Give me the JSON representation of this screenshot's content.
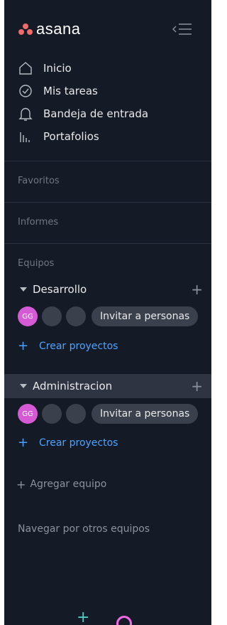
{
  "app": {
    "logo_text": "asana",
    "logo_colors": [
      "#f06a6a",
      "#f06a6a",
      "#f06a6a"
    ],
    "collapse_icon": "sidebar-collapse-icon"
  },
  "nav": {
    "items": [
      {
        "label": "Inicio",
        "icon": "home-icon"
      },
      {
        "label": "Mis tareas",
        "icon": "check-circle-icon"
      },
      {
        "label": "Bandeja de entrada",
        "icon": "bell-icon"
      },
      {
        "label": "Portafolios",
        "icon": "bar-chart-icon"
      }
    ]
  },
  "sections": {
    "favorites": "Favoritos",
    "reports": "Informes",
    "teams": "Equipos"
  },
  "teams": [
    {
      "name": "Desarrollo",
      "active": false,
      "member_initials": "GG",
      "invite_label": "Invitar a personas",
      "create_label": "Crear proyectos"
    },
    {
      "name": "Administracion",
      "active": true,
      "member_initials": "GG",
      "invite_label": "Invitar a personas",
      "create_label": "Crear proyectos"
    }
  ],
  "add_team_label": "Agregar equipo",
  "browse_teams_label": "Navegar por otros equipos",
  "colors": {
    "sidebar_bg": "#151b26",
    "active_bg": "#2e3441",
    "accent_blue": "#4da3ff",
    "avatar_pink": "#d65ad6",
    "plus_teal": "#4ecbc4",
    "help_pink": "#f06ae6"
  }
}
